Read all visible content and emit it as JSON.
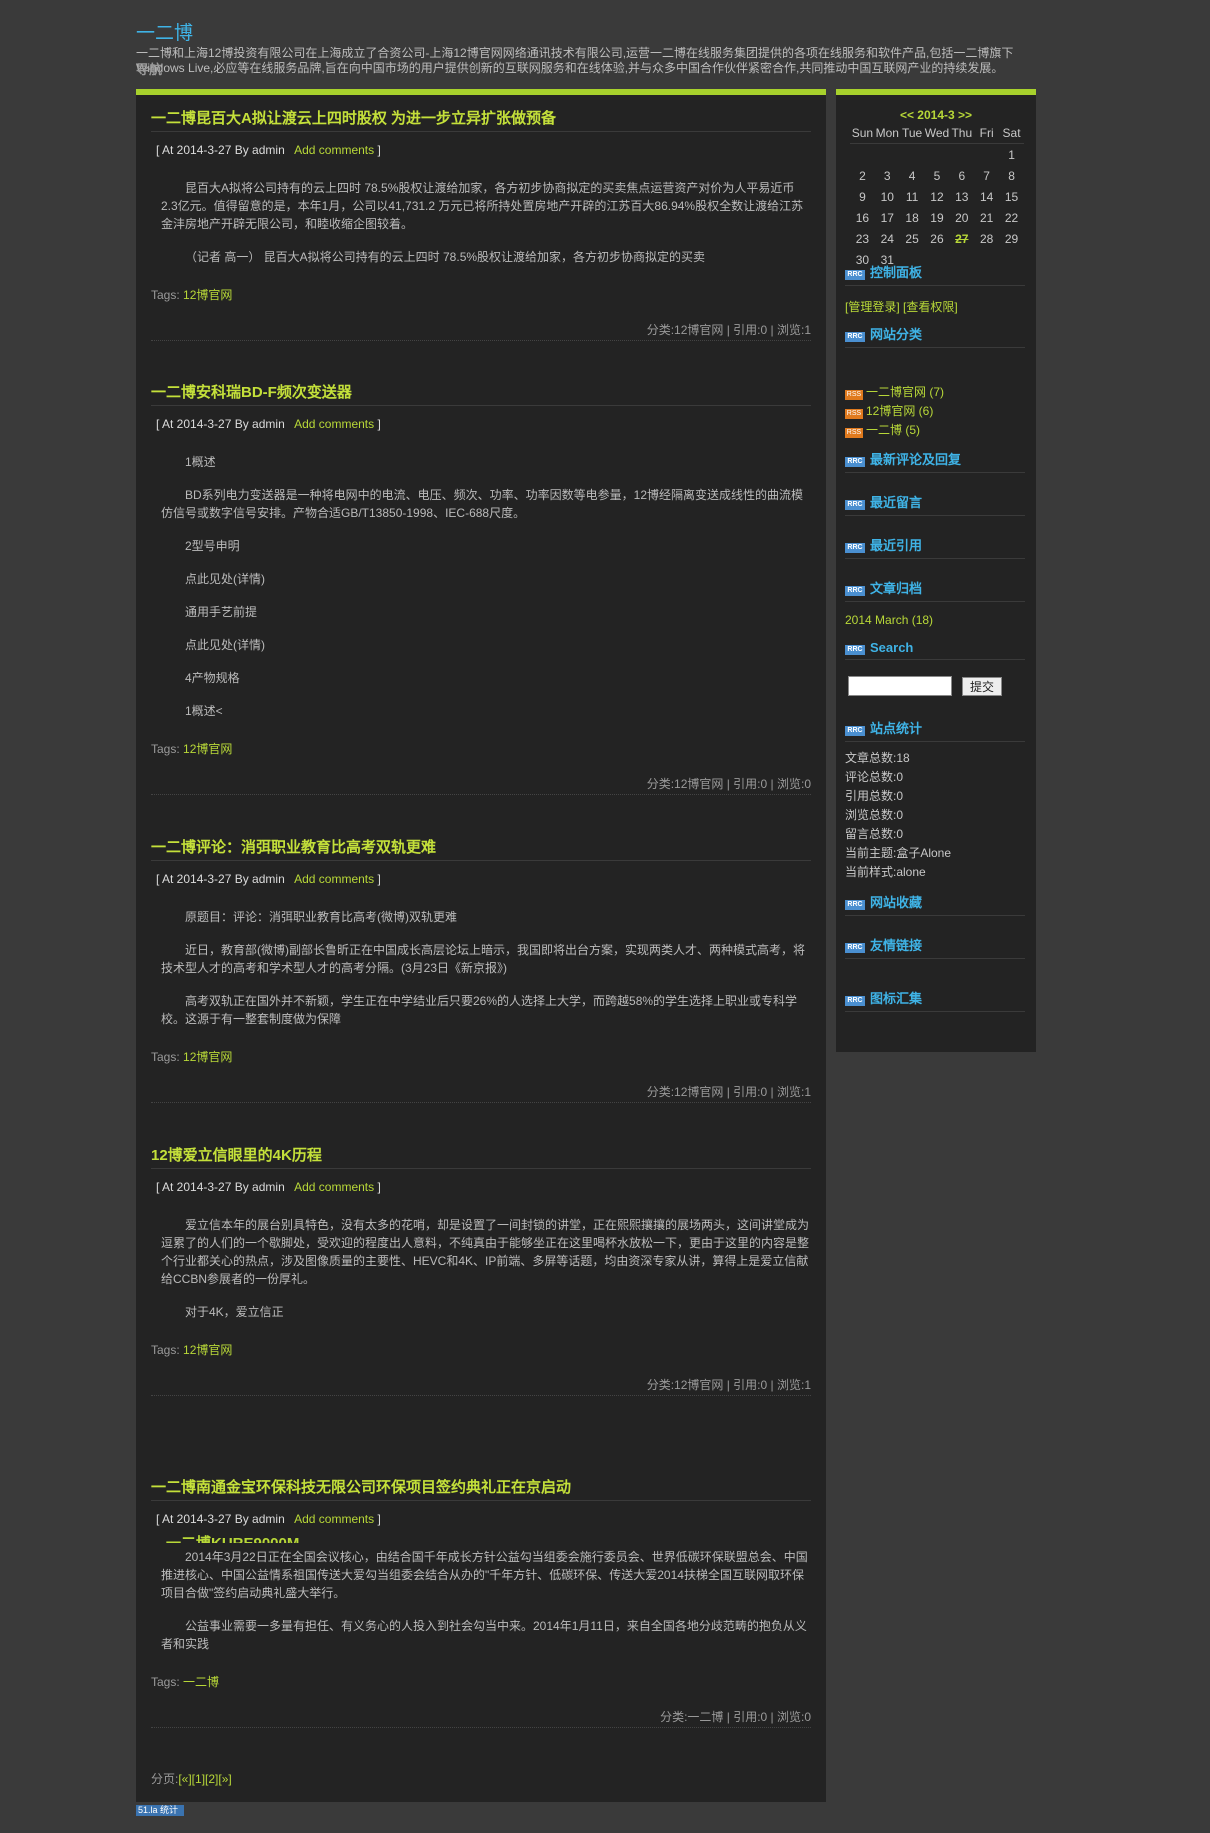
{
  "site": {
    "title": "一二博",
    "description": "一二博和上海12博投资有限公司在上海成立了合资公司-上海12博官网网络通讯技术有限公司,运营一二博在线服务集团提供的各项在线服务和软件产品,包括一二博旗下Windows Live,必应等在线服务品牌,旨在向中国市场的用户提供创新的互联网服务和在线体验,并与众多中国合作伙伴紧密合作,共同推动中国互联网产业的持续发展。",
    "nav_label": "导航"
  },
  "posts": [
    {
      "title": "一二博昆百大A拟让渡云上四时股权 为进一步立异扩张做预备",
      "meta_open": "[ At 2014-3-27 By admin",
      "add_comments": "Add comments",
      "meta_close": "]",
      "paragraphs": [
        "昆百大A拟将公司持有的云上四时 78.5%股权让渡给加家，各方初步协商拟定的买卖焦点运营资产对价为人平易近币2.3亿元。值得留意的是，本年1月，公司以41,731.2 万元已将所持处置房地产开辟的江苏百大86.94%股权全数让渡给江苏金沣房地产开辟无限公司，和睦收缩企图较着。",
        "（记者 高一） 昆百大A拟将公司持有的云上四时 78.5%股权让渡给加家，各方初步协商拟定的买卖"
      ],
      "tags_label": "Tags:",
      "tag": "12博官网",
      "stats": "分类:12博官网 | 引用:0 | 浏览:1"
    },
    {
      "title": "一二博安科瑞BD-F频次变送器",
      "meta_open": "[ At 2014-3-27 By admin",
      "add_comments": "Add comments",
      "meta_close": "]",
      "paragraphs": [
        "1概述",
        "BD系列电力变送器是一种将电网中的电流、电压、频次、功率、功率因数等电参量，12博经隔离变送成线性的曲流模仿信号或数字信号安排。产物合适GB/T13850-1998、IEC-688尺度。",
        "2型号申明",
        "点此见处(详情)",
        "通用手艺前提",
        "点此见处(详情)",
        "4产物规格",
        "1概述<"
      ],
      "tags_label": "Tags:",
      "tag": "12博官网",
      "stats": "分类:12博官网 | 引用:0 | 浏览:0"
    },
    {
      "title": "一二博评论：消弭职业教育比高考双轨更难",
      "meta_open": "[ At 2014-3-27 By admin",
      "add_comments": "Add comments",
      "meta_close": "]",
      "paragraphs": [
        "原题目：评论：消弭职业教育比高考(微博)双轨更难",
        "近日，教育部(微博)副部长鲁昕正在中国成长高层论坛上暗示，我国即将出台方案，实现两类人才、两种模式高考，将技术型人才的高考和学术型人才的高考分隔。(3月23日《新京报》)",
        "高考双轨正在国外并不新颖，学生正在中学结业后只要26%的人选择上大学，而跨越58%的学生选择上职业或专科学校。这源于有一整套制度做为保障"
      ],
      "tags_label": "Tags:",
      "tag": "12博官网",
      "stats": "分类:12博官网 | 引用:0 | 浏览:1"
    },
    {
      "title": "12博爱立信眼里的4K历程",
      "meta_open": "[ At 2014-3-27 By admin",
      "add_comments": "Add comments",
      "meta_close": "]",
      "paragraphs": [
        "爱立信本年的展台别具特色，没有太多的花哨，却是设置了一间封锁的讲堂，正在熙熙攘攘的展场两头，这间讲堂成为逗累了的人们的一个歇脚处，受欢迎的程度出人意料，不纯真由于能够坐正在这里喝杯水放松一下，更由于这里的内容是整个行业都关心的热点，涉及图像质量的主要性、HEVC和4K、IP前端、多屏等话题，均由资深专家从讲，算得上是爱立信献给CCBN参展者的一份厚礼。",
        "对于4K，爱立信正"
      ],
      "tags_label": "Tags:",
      "tag": "12博官网",
      "stats": "分类:12博官网 | 引用:0 | 浏览:1"
    },
    {
      "title": "一二博南通金宝环保科技无限公司环保项目签约典礼正在京启动",
      "meta_open": "[ At 2014-3-27 By admin",
      "add_comments": "Add comments",
      "meta_close": "]",
      "paragraphs": [
        "2014年3月22日正在全国会议核心，由结合国千年成长方针公益勾当组委会施行委员会、世界低碳环保联盟总会、中国推进核心、中国公益情系祖国传送大爱勾当组委会结合从办的\"千年方针、低碳环保、传送大爱2014扶梯全国互联网取环保项目合做\"签约启动典礼盛大举行。",
        "公益事业需要一多量有担任、有义务心的人投入到社会勾当中来。2014年1月11日，来自全国各地分歧范畴的抱负从义者和实践"
      ],
      "tags_label": "Tags:",
      "tag": "一二博",
      "stats": "分类:一二博 | 引用:0 | 浏览:0"
    }
  ],
  "ghost_title": "一二博KURE9000M",
  "pager": {
    "label": "分页:",
    "links": "[«][1][2][»]"
  },
  "sidebar": {
    "calendar": {
      "title": "<< 2014-3 >>",
      "weekdays": [
        "Sun",
        "Mon",
        "Tue",
        "Wed",
        "Thu",
        "Fri",
        "Sat"
      ],
      "rows": [
        [
          "",
          "",
          "",
          "",
          "",
          "",
          "1"
        ],
        [
          "2",
          "3",
          "4",
          "5",
          "6",
          "7",
          "8"
        ],
        [
          "9",
          "10",
          "11",
          "12",
          "13",
          "14",
          "15"
        ],
        [
          "16",
          "17",
          "18",
          "19",
          "20",
          "21",
          "22"
        ],
        [
          "23",
          "24",
          "25",
          "26",
          "27",
          "28",
          "29"
        ],
        [
          "30",
          "31",
          "",
          "",
          "",
          "",
          ""
        ]
      ],
      "today": "27"
    },
    "control_panel": {
      "title": "控制面板",
      "login": "[管理登录]",
      "perm": "[查看权限]"
    },
    "categories": {
      "title": "网站分类",
      "items": [
        "一二博官网 (7)",
        "12博官网 (6)",
        "一二博 (5)"
      ]
    },
    "recent_comments_title": "最新评论及回复",
    "recent_messages_title": "最近留言",
    "recent_refs_title": "最近引用",
    "archive": {
      "title": "文章归档",
      "item": "2014 March (18)"
    },
    "search": {
      "title": "Search",
      "button": "提交"
    },
    "stats": {
      "title": "站点统计",
      "lines": [
        "文章总数:18",
        "评论总数:0",
        "引用总数:0",
        "浏览总数:0",
        "留言总数:0",
        "当前主题:盒子Alone",
        "当前样式:alone"
      ]
    },
    "favorites_title": "网站收藏",
    "links_title": "友情链接",
    "icons_title": "图标汇集",
    "rss_icon_text": "RRC",
    "cat_icon_text": "RSS"
  },
  "footer": {
    "badge": "51.la 统计"
  }
}
